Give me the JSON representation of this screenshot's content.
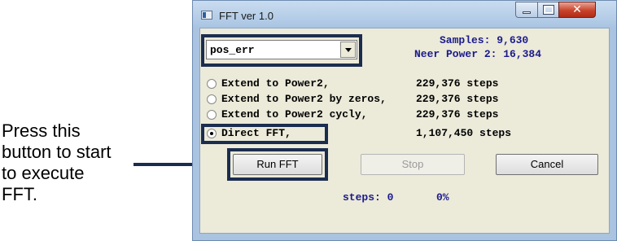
{
  "annotation": {
    "lines": [
      "Press this",
      "button to start",
      "to execute",
      "FFT."
    ]
  },
  "window": {
    "title": "FFT ver 1.0",
    "controls": {
      "minimize": "minimize-icon",
      "maximize": "maximize-icon",
      "close": "close-icon"
    }
  },
  "dropdown": {
    "selected": "pos_err"
  },
  "info": {
    "samples": "Samples: 9,630",
    "neer_power": "Neer Power 2: 16,384"
  },
  "options": [
    {
      "label": "Extend to Power2,",
      "steps": "229,376 steps",
      "selected": false
    },
    {
      "label": "Extend to Power2 by zeros,",
      "steps": "229,376 steps",
      "selected": false
    },
    {
      "label": "Extend to Power2 cycly,",
      "steps": "229,376 steps",
      "selected": false
    },
    {
      "label": "Direct FFT,",
      "steps": "1,107,450 steps",
      "selected": true
    }
  ],
  "buttons": {
    "run": "Run FFT",
    "stop": "Stop",
    "cancel": "Cancel"
  },
  "status": {
    "steps": "steps: 0",
    "percent": "0%"
  },
  "colors": {
    "highlight": "#1b2d4f",
    "dialog_bg": "#ecead9",
    "info_text": "#1a1a8c"
  }
}
